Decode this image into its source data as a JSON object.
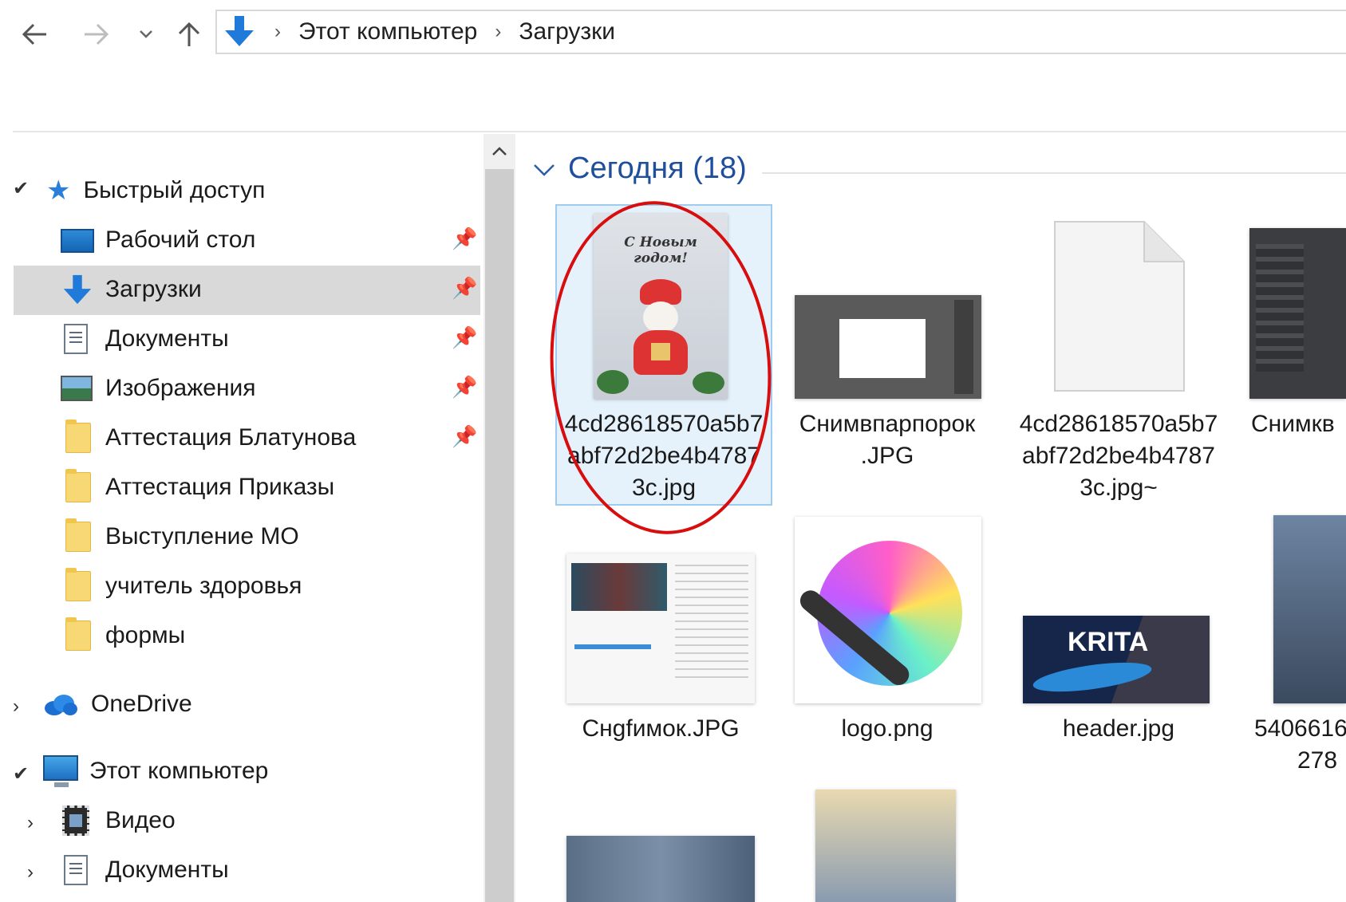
{
  "addressbar": {
    "breadcrumb": [
      "Этот компьютер",
      "Загрузки"
    ]
  },
  "nav": {
    "quick_access": "Быстрый доступ",
    "items": [
      {
        "label": "Рабочий стол",
        "pinned": true,
        "icon": "desktop-icon"
      },
      {
        "label": "Загрузки",
        "pinned": true,
        "icon": "downloads-arrow-icon",
        "selected": true
      },
      {
        "label": "Документы",
        "pinned": true,
        "icon": "document-icon"
      },
      {
        "label": "Изображения",
        "pinned": true,
        "icon": "pictures-icon"
      },
      {
        "label": "Аттестация Блатунова",
        "pinned": true,
        "icon": "folder-icon"
      },
      {
        "label": "Аттестация Приказы",
        "pinned": false,
        "icon": "folder-icon"
      },
      {
        "label": "Выступление МО",
        "pinned": false,
        "icon": "folder-icon"
      },
      {
        "label": "учитель здоровья",
        "pinned": false,
        "icon": "folder-icon"
      },
      {
        "label": "формы",
        "pinned": false,
        "icon": "folder-icon"
      }
    ],
    "onedrive": "OneDrive",
    "this_pc": "Этот компьютер",
    "pc_items": [
      {
        "label": "Видео",
        "icon": "film-icon"
      },
      {
        "label": "Документы",
        "icon": "document-icon"
      }
    ]
  },
  "content": {
    "group_title": "Сегодня (18)",
    "files": [
      {
        "name_lines": [
          "4cd28618570a5b7",
          "abf72d2be4b4787",
          "3c.jpg"
        ],
        "selected": true,
        "annotated": true
      },
      {
        "name_lines": [
          "Снимвпарпорок",
          ".JPG"
        ]
      },
      {
        "name_lines": [
          "4cd28618570a5b7",
          "abf72d2be4b4787",
          "3c.jpg~"
        ]
      },
      {
        "name_lines": [
          "Снимкв"
        ]
      },
      {
        "name_lines": [
          "Снgfимок.JPG"
        ]
      },
      {
        "name_lines": [
          "logo.png"
        ]
      },
      {
        "name_lines": [
          "header.jpg"
        ]
      },
      {
        "name_lines": [
          "5406616",
          "278"
        ]
      }
    ],
    "thumb_texts": {
      "card_greeting": "С Новым годом!",
      "krita_banner": "KRITA"
    }
  },
  "colors": {
    "selection_bg": "#e5f1fb",
    "nav_selected_bg": "#d9d9d9",
    "accent_blue": "#1e4f9c",
    "annotation_red": "#d80d0d",
    "folder_yellow": "#f8d775"
  }
}
